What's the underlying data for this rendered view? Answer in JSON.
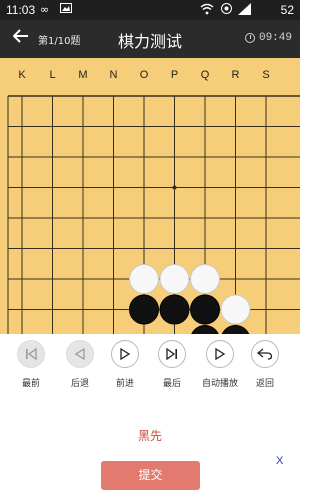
{
  "status_bar": {
    "time": "11:03",
    "icons": [
      "infinity-icon",
      "image-icon",
      "wifi-icon",
      "data-icon",
      "signal-icon"
    ],
    "battery": "52"
  },
  "header": {
    "back_icon": "arrow-left-icon",
    "progress": "第1/10题",
    "title": "棋力测试",
    "timer": "09:49"
  },
  "board": {
    "columns": [
      "K",
      "L",
      "M",
      "N",
      "O",
      "P",
      "Q",
      "R",
      "S"
    ],
    "stones": [
      {
        "color": "white",
        "col": "O",
        "row": 7
      },
      {
        "color": "white",
        "col": "P",
        "row": 7
      },
      {
        "color": "white",
        "col": "Q",
        "row": 7
      },
      {
        "color": "black",
        "col": "O",
        "row": 8
      },
      {
        "color": "black",
        "col": "P",
        "row": 8
      },
      {
        "color": "black",
        "col": "Q",
        "row": 8
      },
      {
        "color": "white",
        "col": "R",
        "row": 8
      },
      {
        "color": "black",
        "col": "Q",
        "row": 9
      },
      {
        "color": "black",
        "col": "R",
        "row": 9
      }
    ],
    "colors": {
      "board": "#f6cd79",
      "line": "#3a2f1f"
    }
  },
  "controls": [
    {
      "id": "first",
      "label": "最前",
      "icon": "skip-to-start-icon",
      "enabled": false
    },
    {
      "id": "back",
      "label": "后退",
      "icon": "step-back-icon",
      "enabled": false
    },
    {
      "id": "forward",
      "label": "前进",
      "icon": "play-icon",
      "enabled": true
    },
    {
      "id": "last",
      "label": "最后",
      "icon": "skip-to-end-icon",
      "enabled": true
    },
    {
      "id": "autoplay",
      "label": "自动播放",
      "icon": "autoplay-icon",
      "enabled": true
    },
    {
      "id": "return",
      "label": "返回",
      "icon": "undo-icon",
      "enabled": true
    }
  ],
  "turn_text": "黑先",
  "submit_label": "提交",
  "close_label": "X",
  "colors": {
    "accent_red": "#d24a3b",
    "submit_bg": "#e27a6f",
    "close_blue": "#2a3bb8"
  }
}
